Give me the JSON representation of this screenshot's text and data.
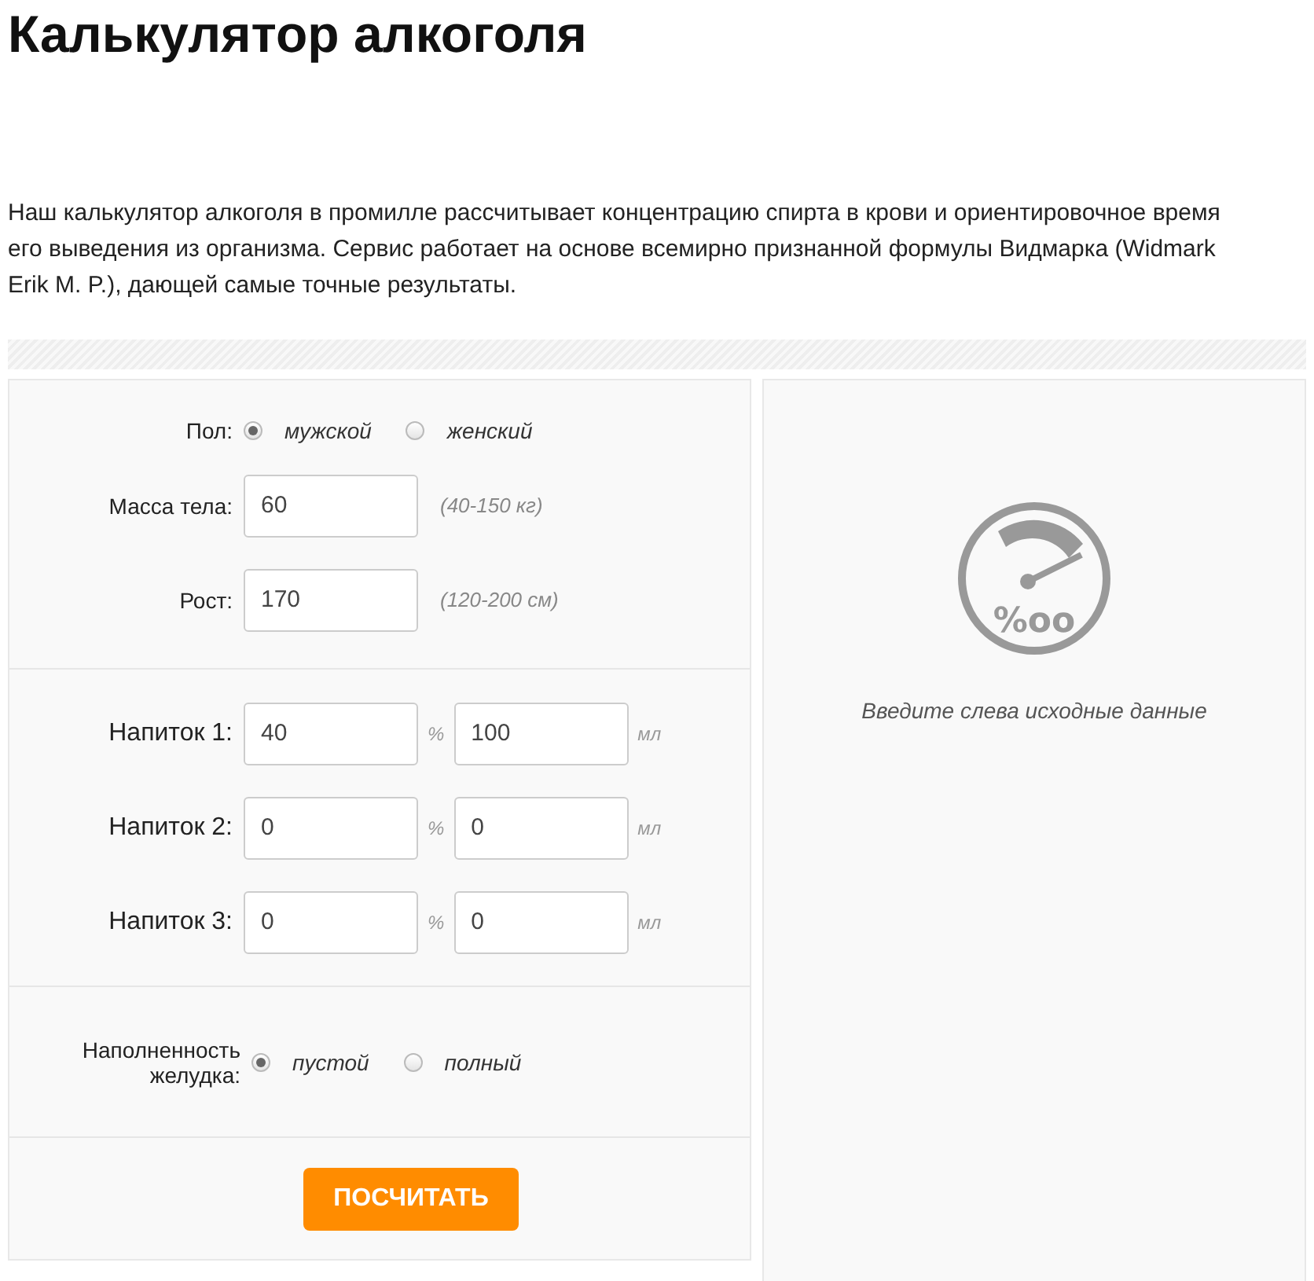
{
  "title": "Калькулятор алкоголя",
  "intro": "Наш калькулятор алкоголя в промилле рассчитывает концентрацию спирта в крови и ориентировочное время его выведения из организма. Сервис работает на основе всемирно признанной формулы Видмарка (Widmark Erik M. P.), дающей самые точные результаты.",
  "form": {
    "sex": {
      "label": "Пол:",
      "options": [
        {
          "label": "мужской",
          "selected": true
        },
        {
          "label": "женский",
          "selected": false
        }
      ]
    },
    "weight": {
      "label": "Масса тела:",
      "value": "60",
      "hint": "(40-150 кг)"
    },
    "height": {
      "label": "Рост:",
      "value": "170",
      "hint": "(120-200 см)"
    },
    "drinks": [
      {
        "label": "Напиток 1:",
        "strength": "40",
        "strength_unit": "%",
        "volume": "100",
        "volume_unit": "мл"
      },
      {
        "label": "Напиток 2:",
        "strength": "0",
        "strength_unit": "%",
        "volume": "0",
        "volume_unit": "мл"
      },
      {
        "label": "Напиток 3:",
        "strength": "0",
        "strength_unit": "%",
        "volume": "0",
        "volume_unit": "мл"
      }
    ],
    "stomach": {
      "label": "Наполненность желудка:",
      "options": [
        {
          "label": "пустой",
          "selected": true
        },
        {
          "label": "полный",
          "selected": false
        }
      ]
    },
    "button": "ПОСЧИТАТЬ"
  },
  "result": {
    "gauge_symbol": "%oo",
    "message": "Введите слева исходные данные"
  }
}
